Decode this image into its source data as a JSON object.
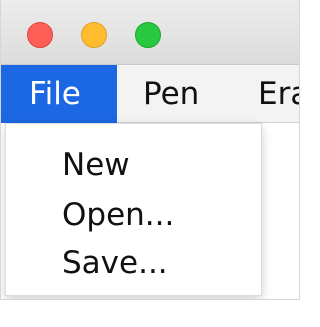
{
  "window": {
    "buttons": {
      "close": {
        "icon": "close-circle-icon",
        "color": "#fe5f57"
      },
      "minimize": {
        "icon": "minimize-circle-icon",
        "color": "#febc2e"
      },
      "maximize": {
        "icon": "maximize-circle-icon",
        "color": "#28c840"
      }
    }
  },
  "menubar": {
    "items": [
      {
        "label": "File",
        "active": true
      },
      {
        "label": "Pen",
        "active": false
      },
      {
        "label": "Era",
        "active": false
      }
    ],
    "active_color": "#1c67e3"
  },
  "file_menu": {
    "items": [
      {
        "label": "New"
      },
      {
        "label": "Open..."
      },
      {
        "label": "Save..."
      }
    ]
  }
}
